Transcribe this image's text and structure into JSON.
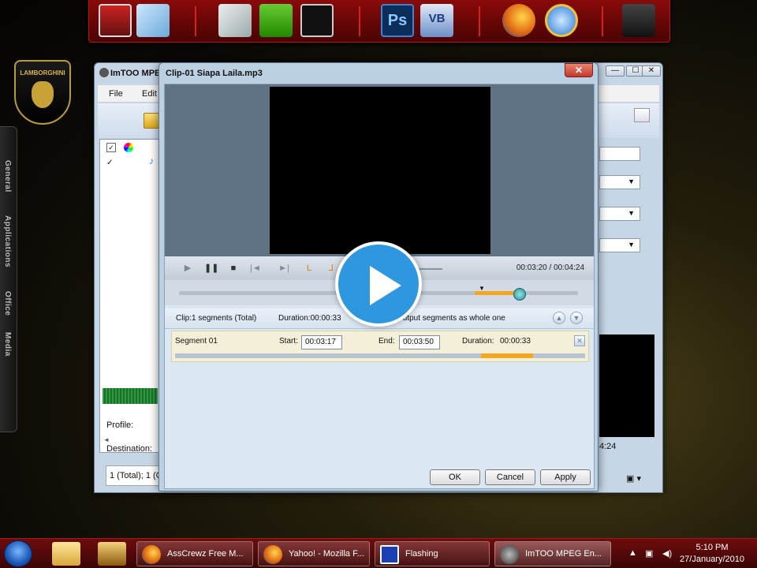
{
  "dock": {
    "icons": [
      "monitor-icon",
      "notepad-icon",
      "folder-icon",
      "task-icon",
      "media-icon",
      "photoshop-icon",
      "visual-basic-icon",
      "firefox-icon",
      "internet-explorer-icon",
      "alienware-icon"
    ],
    "ps_label": "Ps",
    "vb_label": "VB"
  },
  "side_dock": {
    "logo_text": "LAMBORGHINI",
    "tabs": [
      "General",
      "Applications",
      "Office",
      "Media"
    ]
  },
  "back_window": {
    "title": "ImTOO MPEG",
    "menu": [
      "File",
      "Edit"
    ],
    "profile_label": "Profile:",
    "destination_label": "Destination:",
    "status_text": "1 (Total); 1 (C",
    "preview_time": "4:24"
  },
  "dialog": {
    "title": "Clip-01 Siapa Laila.mp3",
    "close_glyph": "✕",
    "time_display": "00:03:20 / 00:04:24",
    "segment_header": {
      "clip_info": "Clip:1 segments (Total)",
      "duration": "Duration:00:00:33",
      "output_option": "Output segments as whole one"
    },
    "segment": {
      "name": "Segment 01",
      "start_label": "Start:",
      "start_value": "00:03:17",
      "end_label": "End:",
      "end_value": "00:03:50",
      "duration_label": "Duration:",
      "duration_value": "00:00:33"
    },
    "buttons": {
      "ok": "OK",
      "cancel": "Cancel",
      "apply": "Apply"
    }
  },
  "taskbar": {
    "items": [
      {
        "label": "AssCrewz Free M...",
        "icon": "firefox-icon"
      },
      {
        "label": "Yahoo! - Mozilla F...",
        "icon": "firefox-icon"
      },
      {
        "label": "Flashing",
        "icon": "app-icon"
      },
      {
        "label": "ImTOO MPEG En...",
        "icon": "film-reel-icon"
      }
    ],
    "clock_time": "5:10 PM",
    "clock_date": "27/January/2010"
  },
  "colors": {
    "dock_red": "#8a0a0a",
    "dialog_bg": "#bcd0e4",
    "segment_orange": "#f5a623",
    "play_blue": "#2f96e0"
  }
}
